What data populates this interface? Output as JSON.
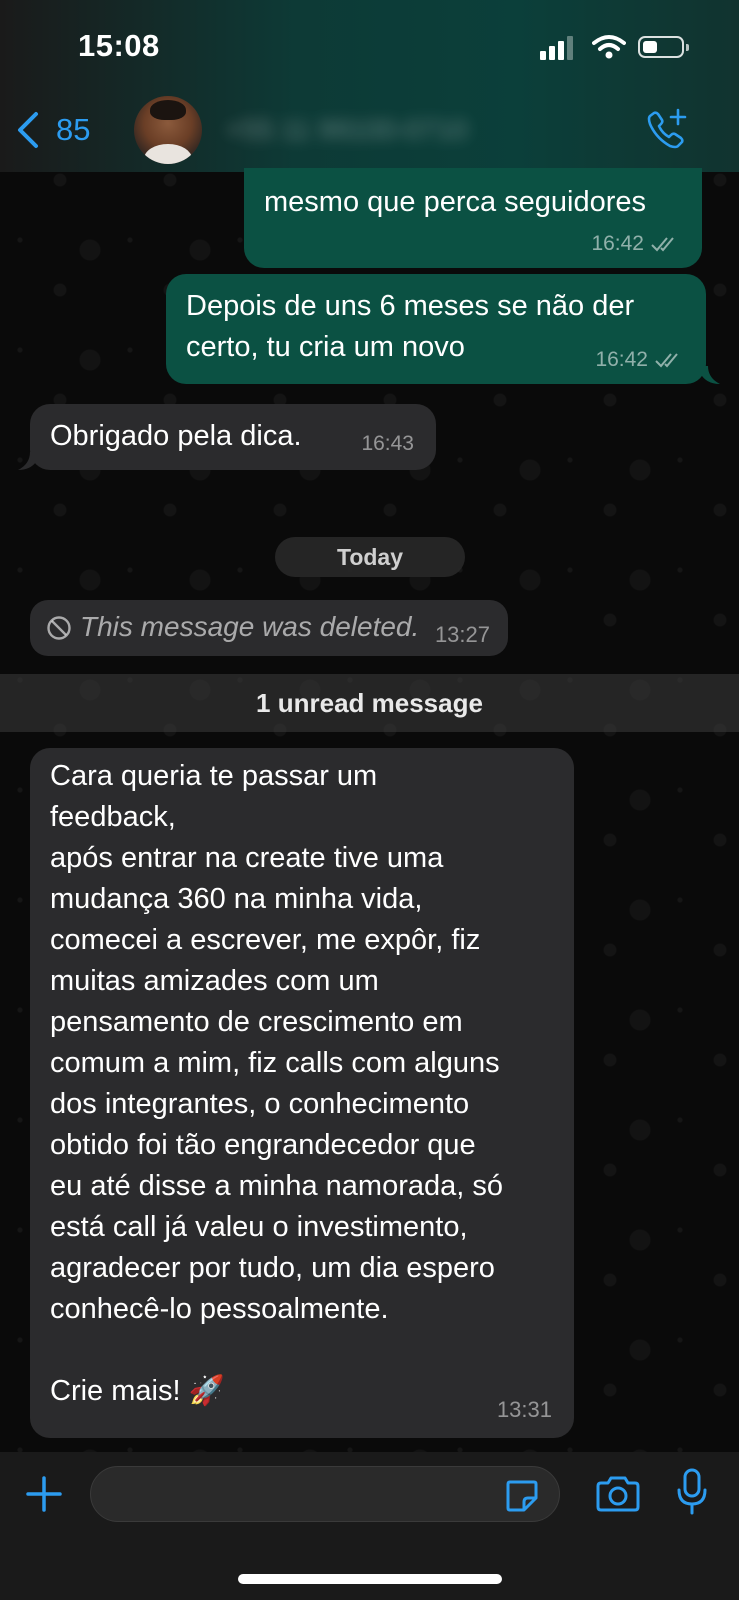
{
  "status_bar": {
    "time": "15:08"
  },
  "header": {
    "back_count": "85",
    "contact_name": "+55 11 99100-0710"
  },
  "messages": [
    {
      "direction": "out",
      "text": "mesmo que perca seguidores",
      "time": "16:42"
    },
    {
      "direction": "out",
      "text": "Depois de uns 6 meses se não der certo, tu cria um novo",
      "time": "16:42"
    },
    {
      "direction": "in",
      "text": "Obrigado pela dica.",
      "time": "16:43"
    }
  ],
  "date_separator": "Today",
  "deleted_message": {
    "text": "This message was deleted.",
    "time": "13:27"
  },
  "unread_banner": "1 unread message",
  "long_message": {
    "text": "Cara queria te passar um\nfeedback,\napós entrar na create tive uma\nmudança 360 na minha vida,\ncomecei a escrever, me expôr, fiz\nmuitas amizades com um\npensamento de crescimento em\ncomum a mim, fiz calls com alguns\ndos integrantes, o conhecimento\nobtido foi tão engrandecedor que\neu até disse a minha namorada, só\nestá call já valeu o investimento,\nagradecer por tudo, um dia espero\nconhecê-lo pessoalmente.\n\nCrie mais! 🚀",
    "time": "13:31"
  },
  "colors": {
    "outgoing_bubble": "#0b5143",
    "incoming_bubble": "#2b2b2d",
    "accent": "#2c9cf0"
  },
  "icons": [
    "chevron-left-icon",
    "signal-icon",
    "wifi-icon",
    "battery-icon",
    "phone-add-icon",
    "double-check-icon",
    "deleted-icon",
    "plus-icon",
    "sticker-icon",
    "camera-icon",
    "microphone-icon"
  ]
}
